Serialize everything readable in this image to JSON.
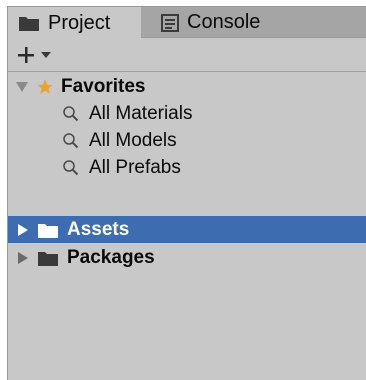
{
  "tabs": [
    {
      "label": "Project",
      "icon": "folder-icon",
      "active": true
    },
    {
      "label": "Console",
      "icon": "console-icon",
      "active": false
    }
  ],
  "toolbar": {
    "add_icon": "plus-icon",
    "dropdown_icon": "caret-down-icon"
  },
  "tree": {
    "favorites": {
      "label": "Favorites",
      "icon": "star-icon",
      "expanded": true,
      "items": [
        {
          "label": "All Materials",
          "icon": "search-icon"
        },
        {
          "label": "All Models",
          "icon": "search-icon"
        },
        {
          "label": "All Prefabs",
          "icon": "search-icon"
        }
      ]
    },
    "roots": [
      {
        "label": "Assets",
        "icon": "folder-icon",
        "selected": true,
        "expanded": false
      },
      {
        "label": "Packages",
        "icon": "folder-icon",
        "selected": false,
        "expanded": false
      }
    ]
  },
  "colors": {
    "panel_bg": "#c8c8c8",
    "tab_strip_bg": "#a5a5a5",
    "selection": "#3d6cb0",
    "star": "#e8a32b",
    "folder": "#3a3a3a"
  }
}
